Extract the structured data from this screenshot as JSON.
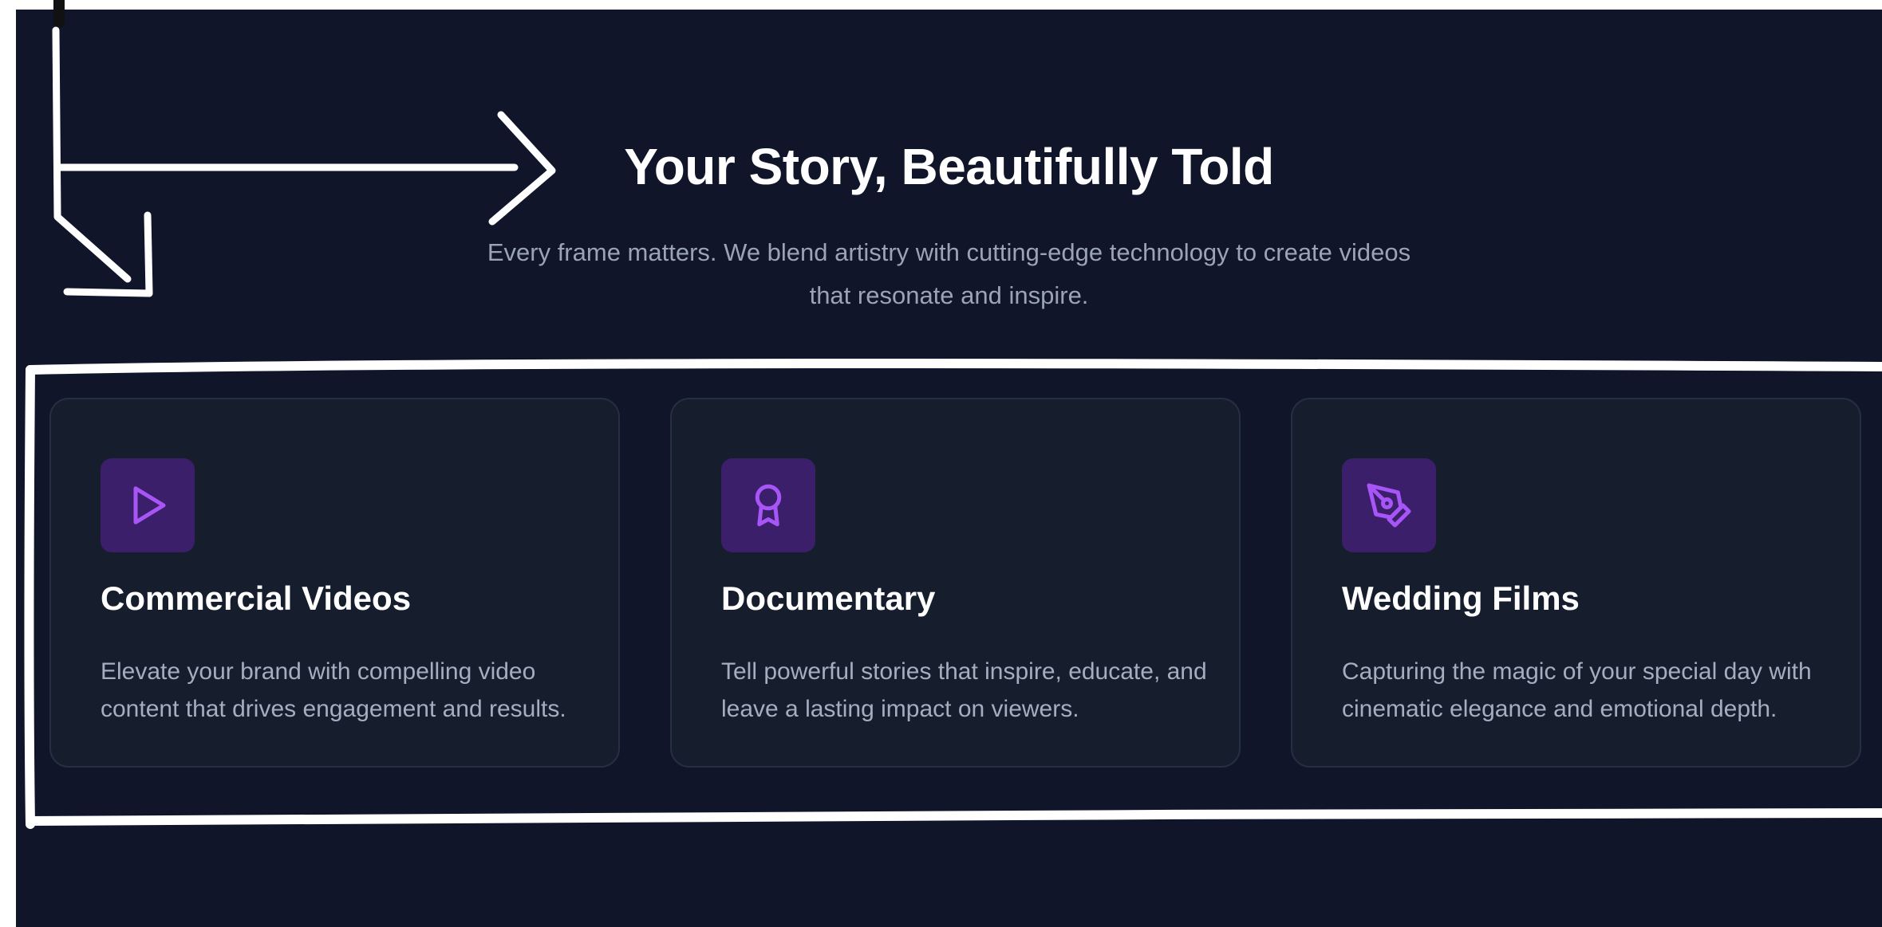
{
  "hero": {
    "title": "Your Story, Beautifully Told",
    "subtitle": "Every frame matters. We blend artistry with cutting-edge technology to create videos that resonate and inspire."
  },
  "services": [
    {
      "icon": "play-icon",
      "title": "Commercial Videos",
      "description": "Elevate your brand with compelling video content that drives engagement and results."
    },
    {
      "icon": "award-ribbon-icon",
      "title": "Documentary",
      "description": "Tell powerful stories that inspire, educate, and leave a lasting impact on viewers."
    },
    {
      "icon": "pen-tool-icon",
      "title": "Wedding Films",
      "description": "Capturing the magic of your special day with cinematic elegance and emotional depth."
    }
  ],
  "colors": {
    "page_background": "#10152a",
    "card_background": "#161d2c",
    "card_border": "#262f42",
    "icon_background": "#3b1f6b",
    "icon_accent": "#a855f7",
    "annotation": "#ffffff"
  }
}
